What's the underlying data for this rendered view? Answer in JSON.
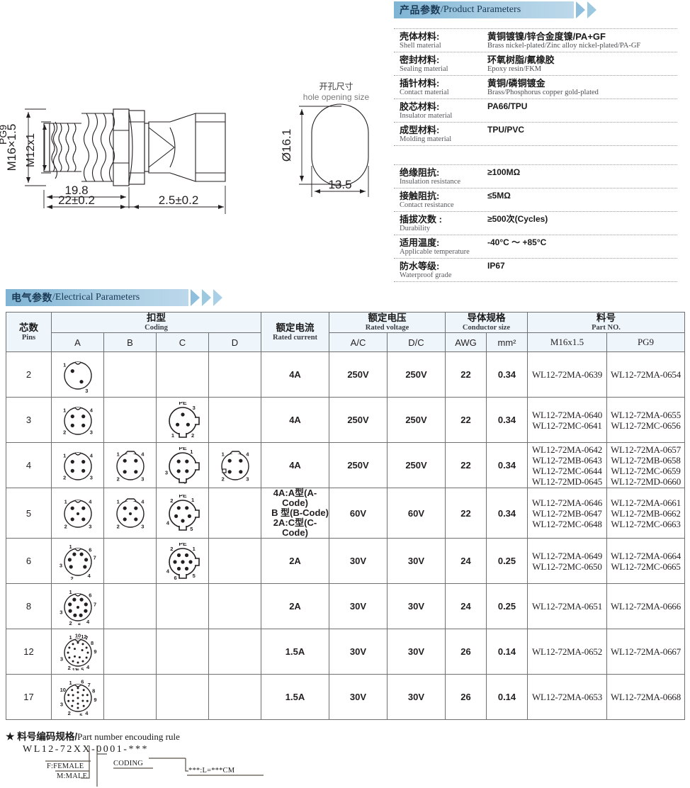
{
  "banners": {
    "product": {
      "cn": "产品参数",
      "sep": "/",
      "en": "Product Parameters"
    },
    "electrical": {
      "cn": "电气参数",
      "sep": "/",
      "en": "Electrical Parameters"
    }
  },
  "materials": [
    {
      "label_cn": "壳体材料:",
      "label_en": "Shell material",
      "value_cn": "黄铜镀镍/锌合金度镍/PA+GF",
      "value_en": "Brass nickel-plated/Zinc alloy nickel-plated/PA-GF"
    },
    {
      "label_cn": "密封材料:",
      "label_en": "Sealing material",
      "value_cn": "环氧树脂/氟橡胶",
      "value_en": "Epoxy resin/FKM"
    },
    {
      "label_cn": "插针材料:",
      "label_en": "Contact material",
      "value_cn": "黄铜/磷铜镀金",
      "value_en": "Brass/Phosphorus copper gold-plated"
    },
    {
      "label_cn": "胶芯材料:",
      "label_en": "Insulator material",
      "value_cn": "PA66/TPU",
      "value_en": ""
    },
    {
      "label_cn": "成型材料:",
      "label_en": "Molding material",
      "value_cn": "TPU/PVC",
      "value_en": ""
    }
  ],
  "performance": [
    {
      "label_cn": "绝缘阻抗:",
      "label_en": "Insulation resistance",
      "value": "≥100MΩ"
    },
    {
      "label_cn": "接触阻抗:",
      "label_en": "Contact resistance",
      "value": "≤5MΩ"
    },
    {
      "label_cn": "插拔次数 :",
      "label_en": "Durability",
      "value": "≥500次(Cycles)"
    },
    {
      "label_cn": "适用温度:",
      "label_en": "Applicable temperature",
      "value": "-40°C ～ +85°C"
    },
    {
      "label_cn": "防水等级:",
      "label_en": "Waterproof grade",
      "value": "IP67"
    }
  ],
  "drawing": {
    "thread_outer": "M16×1.5",
    "thread_pg": "PG9",
    "thread_inner": "M12x1",
    "dim_19_8": "19.8",
    "dim_22": "22±0.2",
    "dim_2_5": "2.5±0.2"
  },
  "hole": {
    "title_cn": "开孔尺寸",
    "title_en": "hole opening size",
    "diameter": "Ø16.1",
    "width": "13.5"
  },
  "table": {
    "headers": {
      "pins_cn": "芯数",
      "pins_en": "Pins",
      "coding_cn": "扣型",
      "coding_en": "Coding",
      "coding_a": "A",
      "coding_b": "B",
      "coding_c": "C",
      "coding_d": "D",
      "current_cn": "额定电流",
      "current_en": "Rated current",
      "voltage_cn": "额定电压",
      "voltage_en": "Rated voltage",
      "voltage_ac": "A/C",
      "voltage_dc": "D/C",
      "conductor_cn": "导体规格",
      "conductor_en": "Conductor size",
      "awg": "AWG",
      "mm2": "mm²",
      "partno_cn": "料号",
      "partno_en": "Part NO.",
      "part_m16": "M16x1.5",
      "part_pg9": "PG9"
    },
    "rows": [
      {
        "pins": "2",
        "coding": {
          "a": "2pin",
          "b": "",
          "c": "",
          "d": ""
        },
        "current": "4A",
        "ac": "250V",
        "dc": "250V",
        "awg": "22",
        "mm2": "0.34",
        "pn_m16": [
          "WL12-72MA-0639"
        ],
        "pn_pg9": [
          "WL12-72MA-0654"
        ]
      },
      {
        "pins": "3",
        "coding": {
          "a": "4pin",
          "b": "",
          "c": "3pinPE",
          "d": ""
        },
        "current": "4A",
        "ac": "250V",
        "dc": "250V",
        "awg": "22",
        "mm2": "0.34",
        "pn_m16": [
          "WL12-72MA-0640",
          "WL12-72MC-0641"
        ],
        "pn_pg9": [
          "WL12-72MA-0655",
          "WL12-72MC-0656"
        ]
      },
      {
        "pins": "4",
        "coding": {
          "a": "4pin",
          "b": "4pinB",
          "c": "4pinPE",
          "d": "4pinD"
        },
        "current": "4A",
        "ac": "250V",
        "dc": "250V",
        "awg": "22",
        "mm2": "0.34",
        "pn_m16": [
          "WL12-72MA-0642",
          "WL12-72MB-0643",
          "WL12-72MC-0644",
          "WL12-72MD-0645"
        ],
        "pn_pg9": [
          "WL12-72MA-0657",
          "WL12-72MB-0658",
          "WL12-72MC-0659",
          "WL12-72MD-0660"
        ]
      },
      {
        "pins": "5",
        "coding": {
          "a": "5pin",
          "b": "5pinB",
          "c": "5pinPE",
          "d": ""
        },
        "current_lines": [
          "4A:A型(A-Code)",
          "B 型(B-Code)",
          "2A:C型(C-Code)"
        ],
        "current": "",
        "ac": "60V",
        "dc": "60V",
        "awg": "22",
        "mm2": "0.34",
        "pn_m16": [
          "WL12-72MA-0646",
          "WL12-72MB-0647",
          "WL12-72MC-0648"
        ],
        "pn_pg9": [
          "WL12-72MA-0661",
          "WL12-72MB-0662",
          "WL12-72MC-0663"
        ]
      },
      {
        "pins": "6",
        "coding": {
          "a": "6pin",
          "b": "",
          "c": "6pinPE",
          "d": ""
        },
        "current": "2A",
        "ac": "30V",
        "dc": "30V",
        "awg": "24",
        "mm2": "0.25",
        "pn_m16": [
          "WL12-72MA-0649",
          "WL12-72MC-0650"
        ],
        "pn_pg9": [
          "WL12-72MA-0664",
          "WL12-72MC-0665"
        ]
      },
      {
        "pins": "8",
        "coding": {
          "a": "8pin",
          "b": "",
          "c": "",
          "d": ""
        },
        "current": "2A",
        "ac": "30V",
        "dc": "30V",
        "awg": "24",
        "mm2": "0.25",
        "pn_m16": [
          "WL12-72MA-0651"
        ],
        "pn_pg9": [
          "WL12-72MA-0666"
        ]
      },
      {
        "pins": "12",
        "coding": {
          "a": "12pin",
          "b": "",
          "c": "",
          "d": ""
        },
        "current": "1.5A",
        "ac": "30V",
        "dc": "30V",
        "awg": "26",
        "mm2": "0.14",
        "pn_m16": [
          "WL12-72MA-0652"
        ],
        "pn_pg9": [
          "WL12-72MA-0667"
        ]
      },
      {
        "pins": "17",
        "coding": {
          "a": "17pin",
          "b": "",
          "c": "",
          "d": ""
        },
        "current": "1.5A",
        "ac": "30V",
        "dc": "30V",
        "awg": "26",
        "mm2": "0.14",
        "pn_m16": [
          "WL12-72MA-0653"
        ],
        "pn_pg9": [
          "WL12-72MA-0668"
        ]
      }
    ]
  },
  "encoding": {
    "star": "★",
    "title_cn": "料号编码规格",
    "title_sep": "/",
    "title_en": "Part number encouding rule",
    "code": "WL12-72XX-0001-***",
    "female": "F:FEMALE",
    "male": "M:MALE",
    "coding": "CODING",
    "length": "***:L=***CM"
  }
}
